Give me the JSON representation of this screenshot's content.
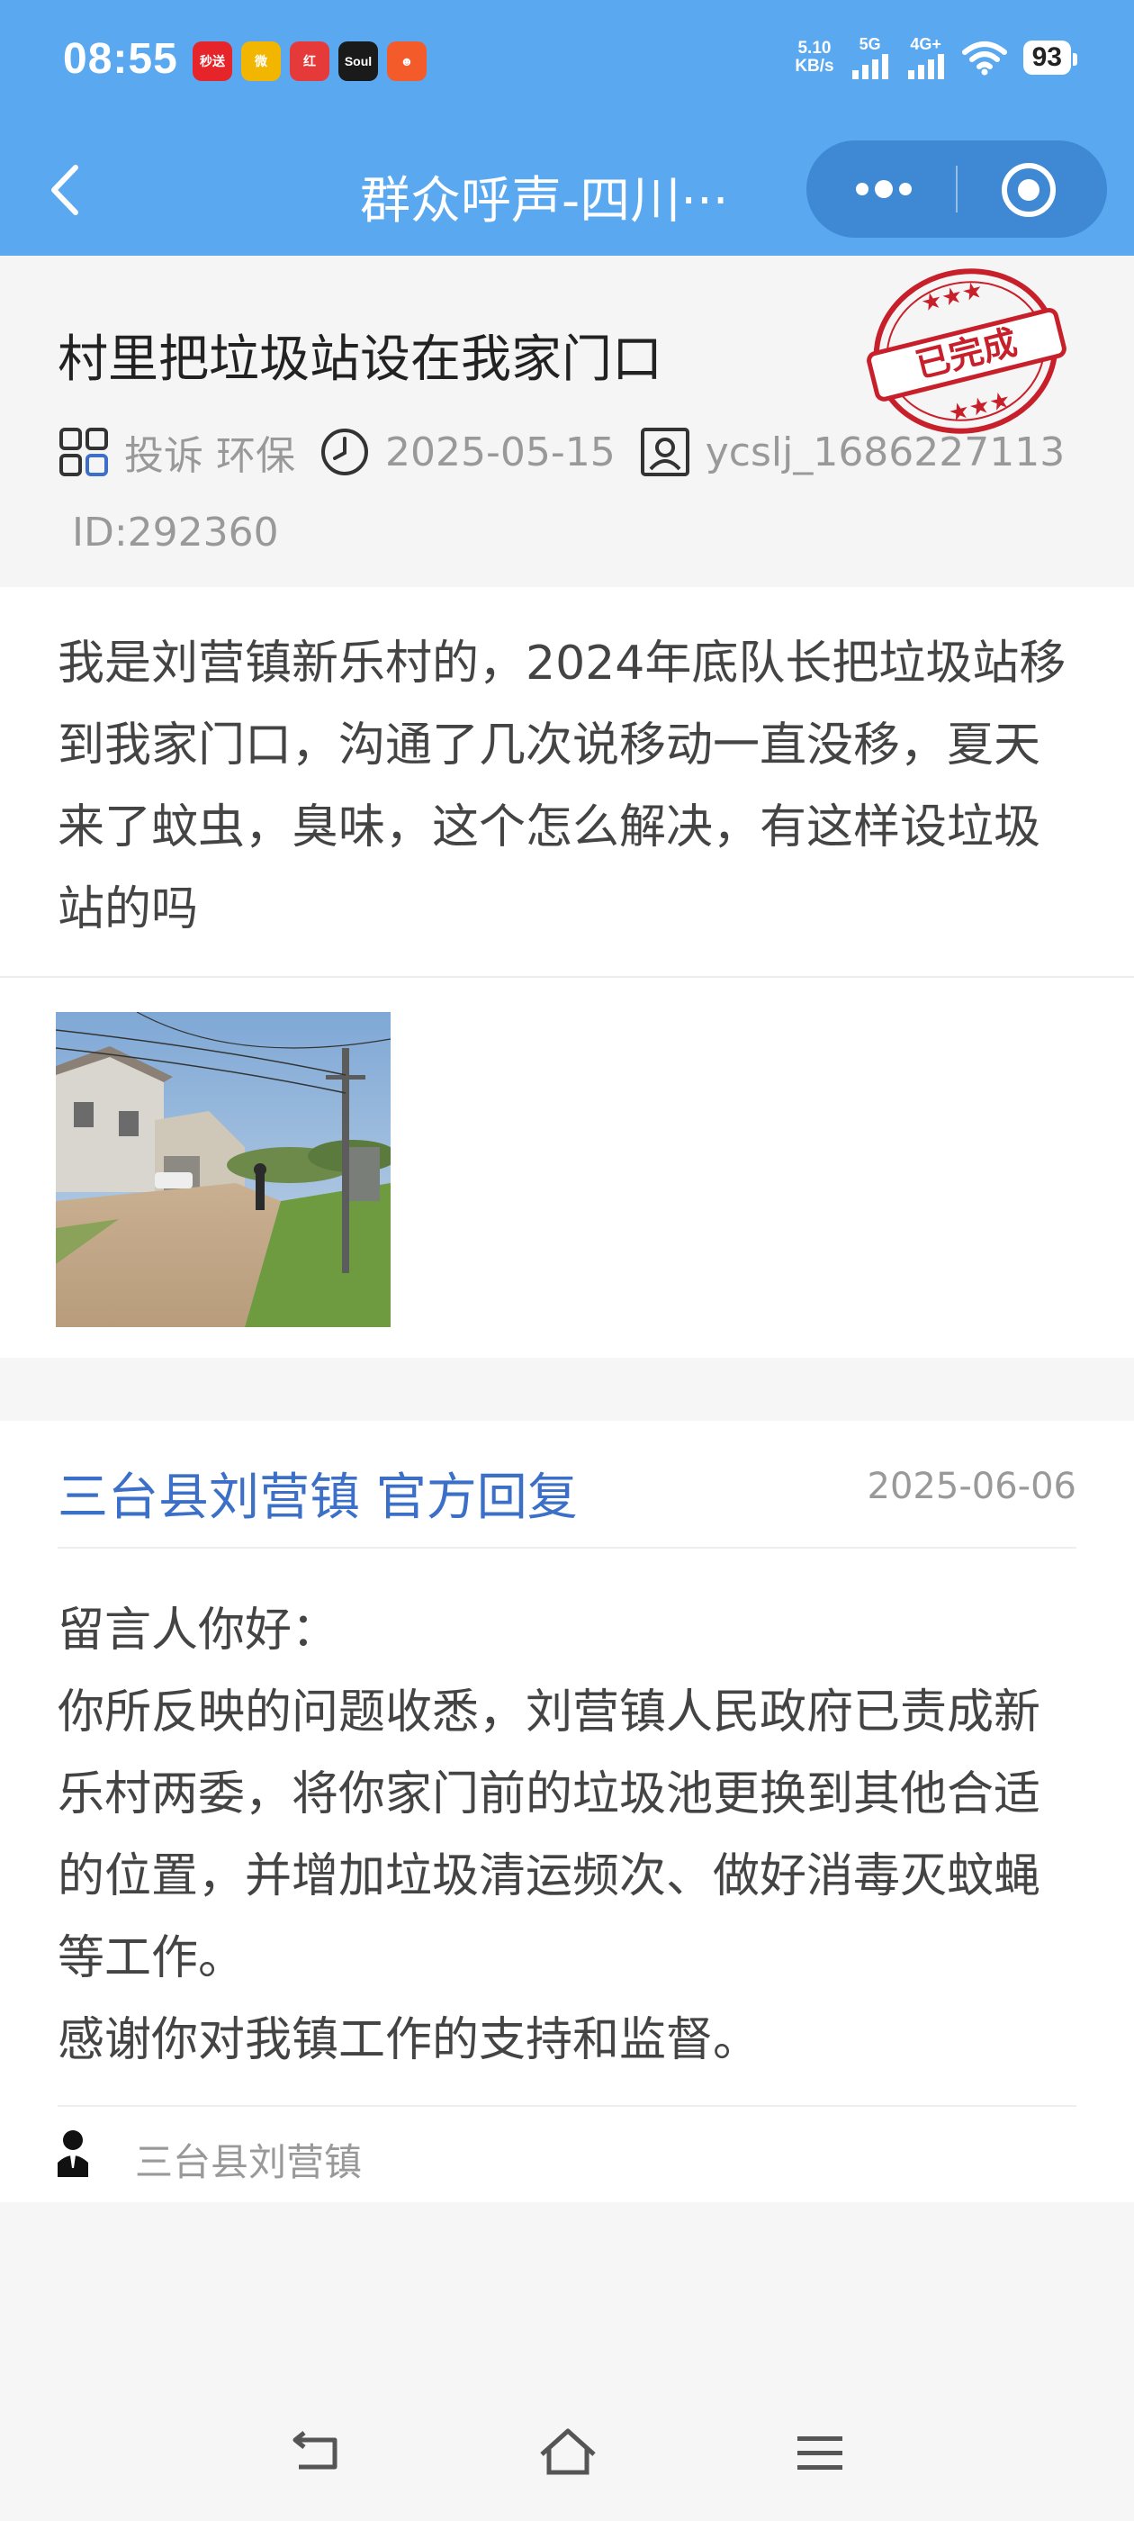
{
  "status_bar": {
    "time": "08:55",
    "apps": [
      {
        "name": "miaosong-app-icon",
        "label": "秒送",
        "color": "#e5252a"
      },
      {
        "name": "weibo-app-icon",
        "label": "微",
        "color": "#f3b600"
      },
      {
        "name": "promo-app-icon",
        "label": "红",
        "color": "#e63a3a"
      },
      {
        "name": "soul-app-icon",
        "label": "Soul",
        "color": "#1a1a1a"
      },
      {
        "name": "game-app-icon",
        "label": "☻",
        "color": "#f45b2a"
      }
    ],
    "net_speed_value": "5.10",
    "net_speed_unit": "KB/s",
    "signal_5g": "5G",
    "signal_4g": "4G+",
    "battery": "93"
  },
  "nav": {
    "title": "群众呼声-四川···",
    "back_icon": "chevron-left-icon",
    "more_icon": "more-dots-icon",
    "close_icon": "target-close-icon"
  },
  "post": {
    "title": "村里把垃圾站设在我家门口",
    "category": "投诉 环保",
    "date": "2025-05-15",
    "user": "ycslj_1686227113",
    "id": "ID:292360",
    "stamp": "已完成",
    "body": "我是刘营镇新乐村的，2024年底队长把垃圾站移到我家门口，沟通了几次说移动一直没移，夏天来了蚊虫，臭味，这个怎么解决，有这样设垃圾站的吗"
  },
  "reply": {
    "org": "三台县刘营镇 官方回复",
    "date": "2025-06-06",
    "greeting": "留言人你好：",
    "content": "你所反映的问题收悉，刘营镇人民政府已责成新乐村两委，将你家门前的垃圾池更换到其他合适的位置，并增加垃圾清运频次、做好消毒灭蚊蝇等工作。",
    "thanks": "感谢你对我镇工作的支持和监督。",
    "signer": "三台县刘营镇"
  },
  "colors": {
    "header_blue": "#5aa8f0",
    "reply_org_blue": "#3b6fc8",
    "stamp_red": "#c8202a"
  }
}
